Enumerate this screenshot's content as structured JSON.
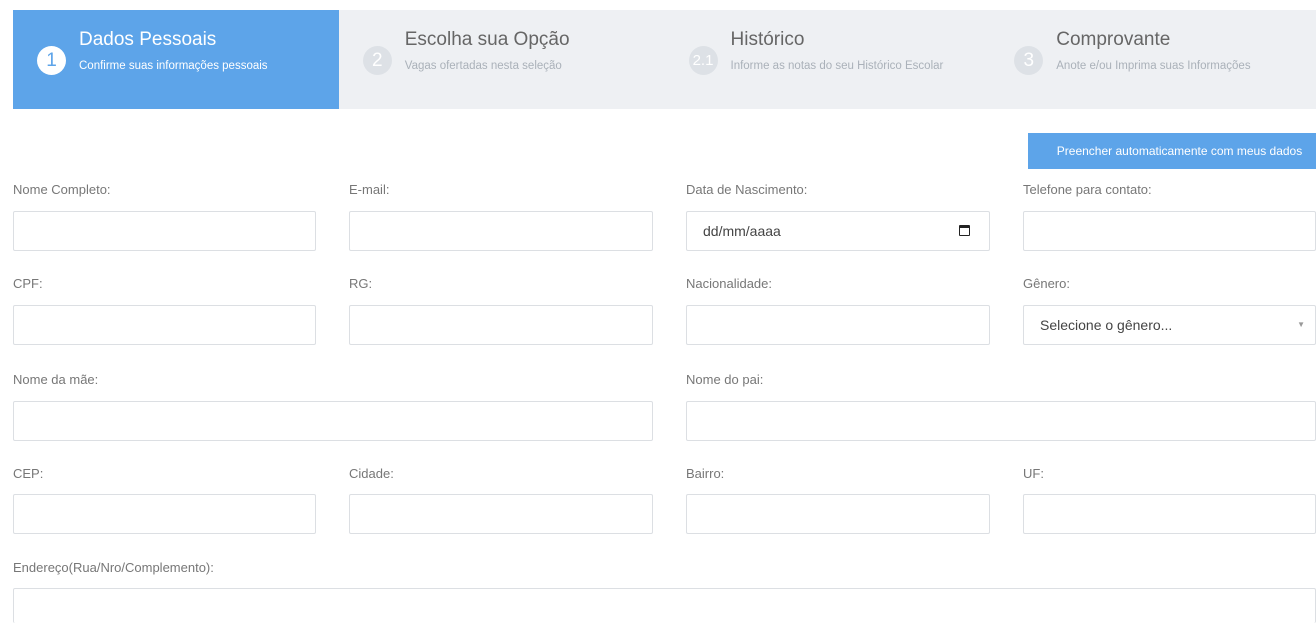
{
  "wizard": {
    "steps": [
      {
        "num": "1",
        "title": "Dados Pessoais",
        "subtitle": "Confirme suas informações pessoais"
      },
      {
        "num": "2",
        "title": "Escolha sua Opção",
        "subtitle": "Vagas ofertadas nesta seleção"
      },
      {
        "num": "2.1",
        "title": "Histórico",
        "subtitle": "Informe as notas do seu Histórico Escolar"
      },
      {
        "num": "3",
        "title": "Comprovante",
        "subtitle": "Anote e/ou Imprima suas Informações"
      }
    ]
  },
  "autofill_label": "Preencher automaticamente com meus dados",
  "form": {
    "nome_completo": {
      "label": "Nome Completo:",
      "value": ""
    },
    "email": {
      "label": "E-mail:",
      "value": ""
    },
    "data_nascimento": {
      "label": "Data de Nascimento:",
      "placeholder": "dd/mm/aaaa"
    },
    "telefone": {
      "label": "Telefone para contato:",
      "value": ""
    },
    "cpf": {
      "label": "CPF:",
      "value": ""
    },
    "rg": {
      "label": "RG:",
      "value": ""
    },
    "nacionalidade": {
      "label": "Nacionalidade:",
      "value": ""
    },
    "genero": {
      "label": "Gênero:",
      "selected": "Selecione o gênero..."
    },
    "nome_mae": {
      "label": "Nome da mãe:",
      "value": ""
    },
    "nome_pai": {
      "label": "Nome do pai:",
      "value": ""
    },
    "cep": {
      "label": "CEP:",
      "value": ""
    },
    "cidade": {
      "label": "Cidade:",
      "value": ""
    },
    "bairro": {
      "label": "Bairro:",
      "value": ""
    },
    "uf": {
      "label": "UF:",
      "value": ""
    },
    "endereco": {
      "label": "Endereço(Rua/Nro/Complemento):",
      "value": ""
    }
  }
}
